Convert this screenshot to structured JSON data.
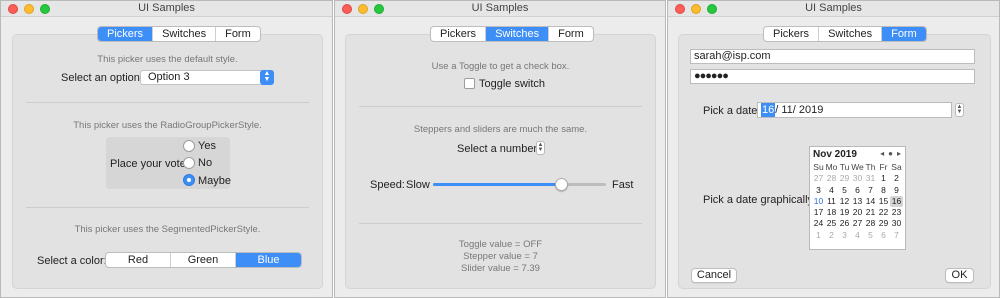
{
  "colors": {
    "accent": "#3d8ef7",
    "window_bg": "#ececec",
    "panel_bg": "#e2e2e2",
    "close": "#fc5d57",
    "minimize": "#fdbc2e",
    "zoom": "#27c840"
  },
  "tabs": [
    "Pickers",
    "Switches",
    "Form"
  ],
  "window1": {
    "title": "UI Samples",
    "active_tab": "Pickers",
    "default_style_caption": "This picker uses the default style.",
    "option_label": "Select an option:",
    "option_value": "Option 3",
    "radiogroup_caption": "This picker uses the RadioGroupPickerStyle.",
    "vote_label": "Place your vote:",
    "vote_options": [
      "Yes",
      "No",
      "Maybe"
    ],
    "vote_selected": "Maybe",
    "segmented_caption": "This picker uses the SegmentedPickerStyle.",
    "color_label": "Select a color:",
    "color_options": [
      "Red",
      "Green",
      "Blue"
    ],
    "color_selected": "Blue"
  },
  "window2": {
    "title": "UI Samples",
    "active_tab": "Switches",
    "toggle_caption": "Use a Toggle to get a check box.",
    "toggle_label": "Toggle switch",
    "toggle_checked": false,
    "stepper_caption": "Steppers and sliders are much the same.",
    "number_label": "Select a number:",
    "speed_label": "Speed:",
    "slow_label": "Slow",
    "fast_label": "Fast",
    "slider_fraction": 0.739,
    "toggle_value_text": "Toggle value = OFF",
    "stepper_value_text": "Stepper value = 7",
    "slider_value_text": "Slider value = 7.39"
  },
  "window3": {
    "title": "UI Samples",
    "active_tab": "Form",
    "email_value": "sarah@isp.com",
    "password_value": "●●●●●●",
    "date_label": "Pick a date:",
    "date_day": "16",
    "date_rest": "/ 11/ 2019",
    "graphical_label": "Pick a date graphically:",
    "calendar": {
      "month_label": "Nov 2019",
      "nav": [
        "◂",
        "●",
        "▸"
      ],
      "weekdays": [
        "Su",
        "Mo",
        "Tu",
        "We",
        "Th",
        "Fr",
        "Sa"
      ],
      "days": [
        [
          "27",
          "other"
        ],
        [
          "28",
          "other"
        ],
        [
          "29",
          "other"
        ],
        [
          "30",
          "other"
        ],
        [
          "31",
          "other"
        ],
        [
          "1",
          ""
        ],
        [
          "2",
          ""
        ],
        [
          "3",
          ""
        ],
        [
          "4",
          ""
        ],
        [
          "5",
          ""
        ],
        [
          "6",
          ""
        ],
        [
          "7",
          ""
        ],
        [
          "8",
          ""
        ],
        [
          "9",
          ""
        ],
        [
          "10",
          "today"
        ],
        [
          "11",
          ""
        ],
        [
          "12",
          ""
        ],
        [
          "13",
          ""
        ],
        [
          "14",
          ""
        ],
        [
          "15",
          ""
        ],
        [
          "16",
          "sel"
        ],
        [
          "17",
          ""
        ],
        [
          "18",
          ""
        ],
        [
          "19",
          ""
        ],
        [
          "20",
          ""
        ],
        [
          "21",
          ""
        ],
        [
          "22",
          ""
        ],
        [
          "23",
          ""
        ],
        [
          "24",
          ""
        ],
        [
          "25",
          ""
        ],
        [
          "26",
          ""
        ],
        [
          "27",
          ""
        ],
        [
          "28",
          ""
        ],
        [
          "29",
          ""
        ],
        [
          "30",
          ""
        ],
        [
          "1",
          "other"
        ],
        [
          "2",
          "other"
        ],
        [
          "3",
          "other"
        ],
        [
          "4",
          "other"
        ],
        [
          "5",
          "other"
        ],
        [
          "6",
          "other"
        ],
        [
          "7",
          "other"
        ]
      ]
    },
    "cancel_label": "Cancel",
    "ok_label": "OK"
  }
}
